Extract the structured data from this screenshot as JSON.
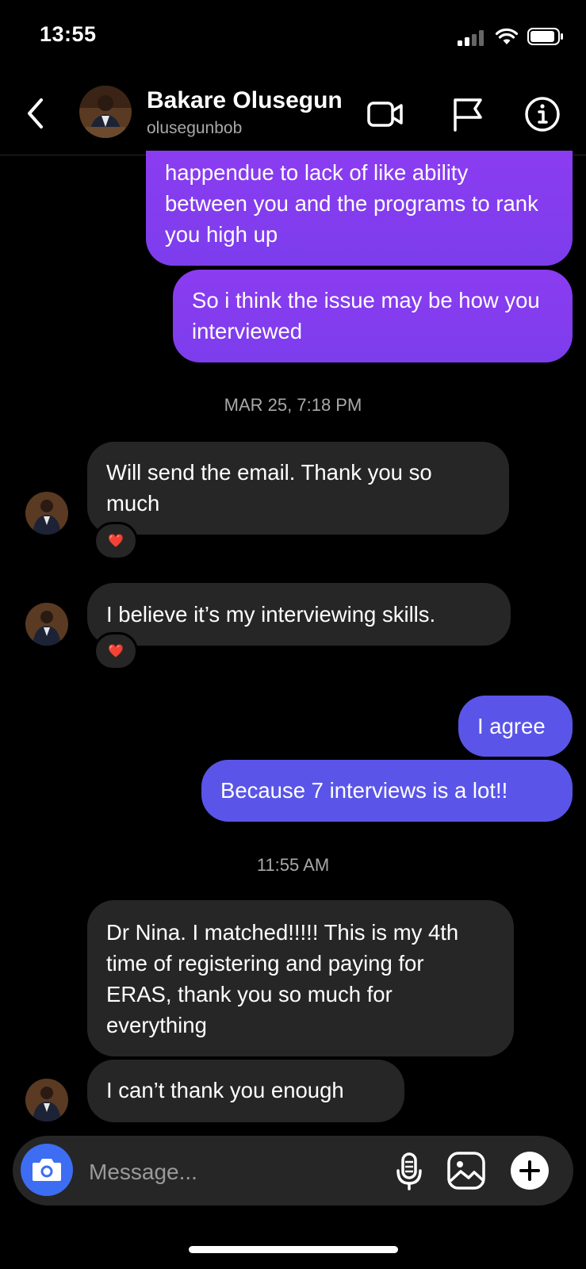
{
  "status_bar": {
    "time": "13:55"
  },
  "header": {
    "name": "Bakare Olusegun",
    "username": "olusegunbob"
  },
  "messages": {
    "m1": "happendue to lack of like ability between you and the programs to rank you high up",
    "m2": "So i think the issue may be how you interviewed",
    "ts1": "MAR 25, 7:18 PM",
    "m3": "Will send the email. Thank you so much",
    "m4": "I believe it’s my interviewing skills.",
    "m5": "I agree",
    "m6": "Because 7 interviews is a lot!!",
    "ts2": "11:55 AM",
    "m7": "Dr Nina.  I matched!!!!!  This is my 4th time of registering and paying for ERAS,  thank you so much for everything",
    "m8": "I can’t thank you enough"
  },
  "reactions": {
    "heart": "❤️"
  },
  "composer": {
    "placeholder": "Message..."
  },
  "colors": {
    "sent_purple": "#8b3cf0",
    "sent_blue": "#5a55e8",
    "received": "#262626",
    "camera": "#3d6df2"
  },
  "icons": [
    "back-chevron-icon",
    "video-call-icon",
    "flag-icon",
    "info-icon",
    "camera-icon",
    "microphone-icon",
    "gallery-icon",
    "plus-icon"
  ]
}
